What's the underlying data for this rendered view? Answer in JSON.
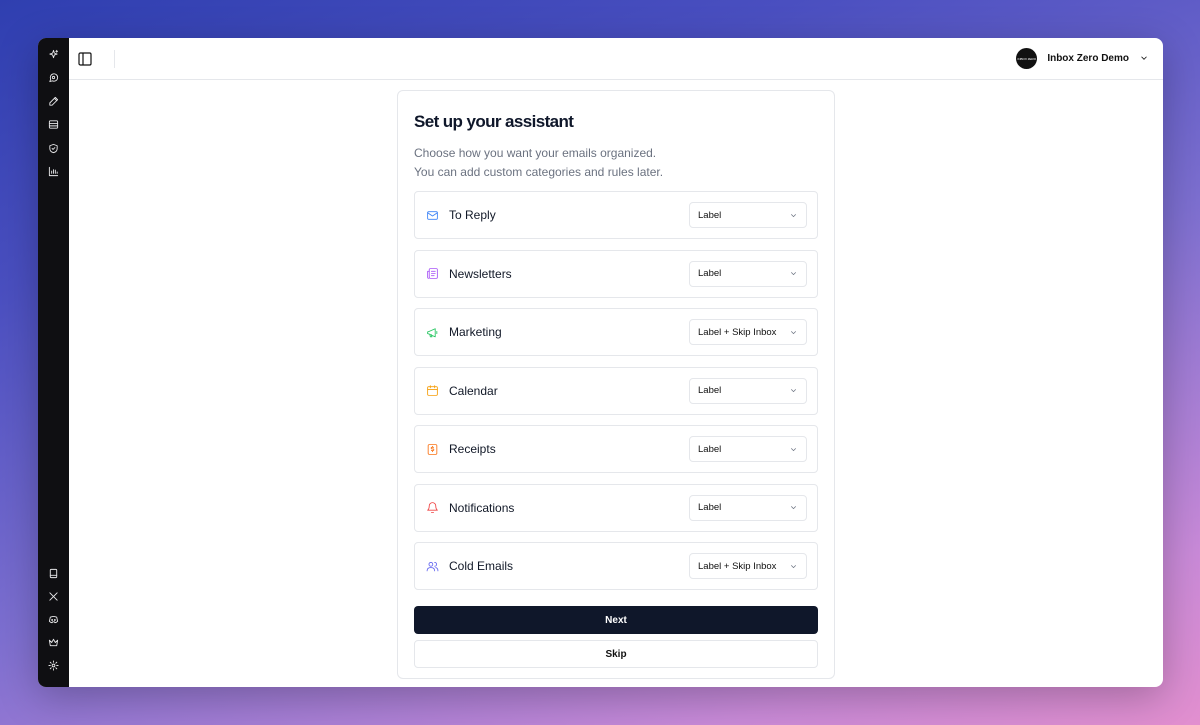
{
  "rail": {
    "top_items": [
      {
        "icon": "sparkles-icon"
      },
      {
        "icon": "chat-icon"
      },
      {
        "icon": "pen-icon"
      },
      {
        "icon": "archive-icon"
      },
      {
        "icon": "shield-icon"
      },
      {
        "icon": "bar-chart-icon"
      }
    ],
    "bottom_items": [
      {
        "icon": "book-icon"
      },
      {
        "icon": "x-logo-icon"
      },
      {
        "icon": "discord-icon"
      },
      {
        "icon": "crown-icon"
      },
      {
        "icon": "settings-icon"
      }
    ]
  },
  "header": {
    "account_name": "Inbox Zero Demo"
  },
  "onboarding": {
    "title": "Set up your assistant",
    "subtitle_line1": "Choose how you want your emails organized.",
    "subtitle_line2": "You can add custom categories and rules later.",
    "categories": [
      {
        "label": "To Reply",
        "value": "Label",
        "icon": "mail-icon",
        "color": "#3b82f6"
      },
      {
        "label": "Newsletters",
        "value": "Label",
        "icon": "newspaper-icon",
        "color": "#a855f7"
      },
      {
        "label": "Marketing",
        "value": "Label + Skip Inbox",
        "icon": "megaphone-icon",
        "color": "#22c55e"
      },
      {
        "label": "Calendar",
        "value": "Label",
        "icon": "calendar-icon",
        "color": "#f59e0b"
      },
      {
        "label": "Receipts",
        "value": "Label",
        "icon": "receipt-icon",
        "color": "#f97316"
      },
      {
        "label": "Notifications",
        "value": "Label",
        "icon": "bell-icon",
        "color": "#ef4444"
      },
      {
        "label": "Cold Emails",
        "value": "Label + Skip Inbox",
        "icon": "users-icon",
        "color": "#6366f1"
      }
    ],
    "next_label": "Next",
    "skip_label": "Skip"
  }
}
